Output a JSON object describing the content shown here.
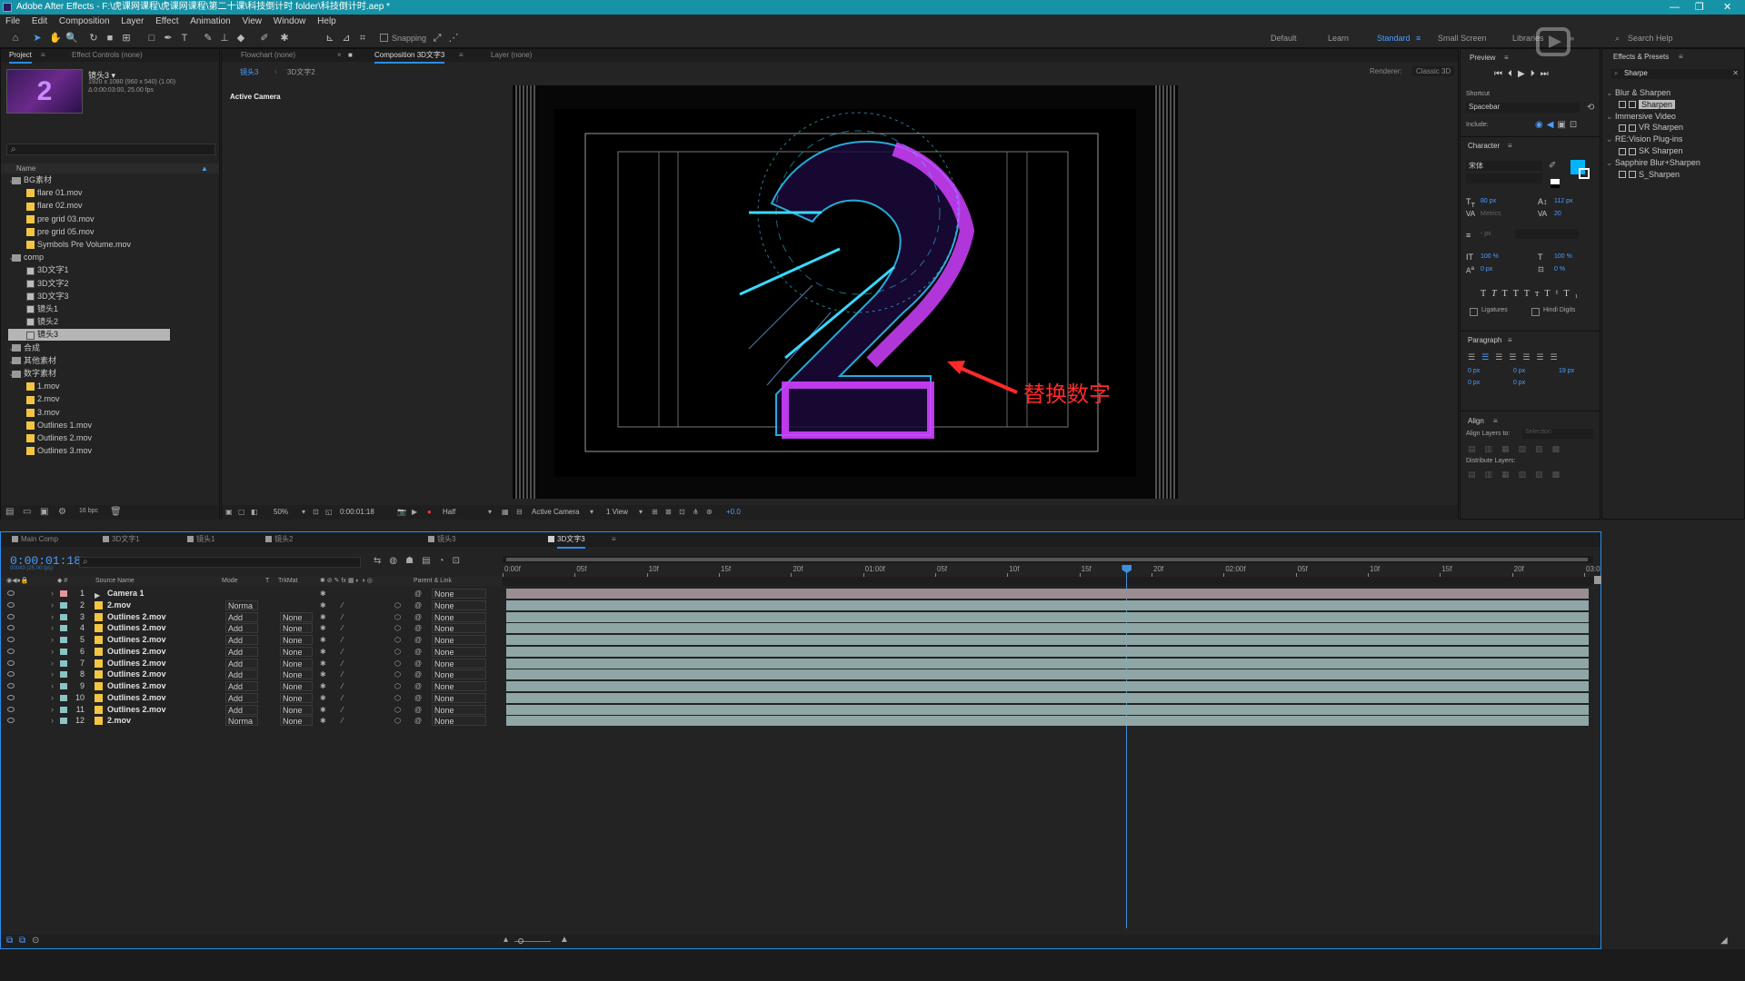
{
  "window": {
    "title": "Adobe After Effects - F:\\虎课网课程\\虎课网课程\\第二十课\\科技倒计时 folder\\科技倒计时.aep *"
  },
  "menu": [
    "File",
    "Edit",
    "Composition",
    "Layer",
    "Effect",
    "Animation",
    "View",
    "Window",
    "Help"
  ],
  "toolbar": {
    "snapping": "Snapping",
    "workspaces": [
      "Default",
      "Learn",
      "Standard",
      "Small Screen",
      "Libraries"
    ],
    "search_help": "Search Help"
  },
  "project": {
    "tab": "Project",
    "tab_effects": "Effect Controls (none)",
    "item_name": "镜头3 ▾",
    "item_info1": "1920 x 1080  (960 x 540) (1.00)",
    "item_info2": "Δ 0:00:03:00, 25.00 fps",
    "col_name": "Name",
    "rows": [
      {
        "t": "folder",
        "label": "BG素材",
        "indent": 0
      },
      {
        "t": "file",
        "label": "flare 01.mov",
        "indent": 1
      },
      {
        "t": "file",
        "label": "flare 02.mov",
        "indent": 1
      },
      {
        "t": "file",
        "label": "pre grid 03.mov",
        "indent": 1
      },
      {
        "t": "file",
        "label": "pre grid 05.mov",
        "indent": 1
      },
      {
        "t": "file",
        "label": "Symbols Pre Volume.mov",
        "indent": 1
      },
      {
        "t": "folder",
        "label": "comp",
        "indent": 0
      },
      {
        "t": "comp",
        "label": "3D文字1",
        "indent": 1
      },
      {
        "t": "comp",
        "label": "3D文字2",
        "indent": 1
      },
      {
        "t": "comp",
        "label": "3D文字3",
        "indent": 1
      },
      {
        "t": "comp",
        "label": "镜头1",
        "indent": 1
      },
      {
        "t": "comp",
        "label": "镜头2",
        "indent": 1
      },
      {
        "t": "comp",
        "label": "镜头3",
        "indent": 1,
        "sel": true
      },
      {
        "t": "folder",
        "label": "合成",
        "indent": 0
      },
      {
        "t": "folder",
        "label": "其他素材",
        "indent": 0
      },
      {
        "t": "folder",
        "label": "数字素材",
        "indent": 0
      },
      {
        "t": "file",
        "label": "1.mov",
        "indent": 1
      },
      {
        "t": "file",
        "label": "2.mov",
        "indent": 1
      },
      {
        "t": "file",
        "label": "3.mov",
        "indent": 1
      },
      {
        "t": "file",
        "label": "Outlines 1.mov",
        "indent": 1
      },
      {
        "t": "file",
        "label": "Outlines 2.mov",
        "indent": 1
      },
      {
        "t": "file",
        "label": "Outlines 3.mov",
        "indent": 1
      }
    ],
    "bpc": "16 bpc"
  },
  "viewer": {
    "tab_flowchart": "Flowchart (none)",
    "tab_comp": "Composition 3D文字3",
    "tab_layer": "Layer (none)",
    "sub_tabs": [
      "镜头3",
      "3D文字2"
    ],
    "renderer_label": "Renderer:",
    "renderer": "Classic 3D",
    "active_camera": "Active Camera",
    "annotation": "替换数字",
    "digit": "2",
    "zoom": "50%",
    "timecode": "0:00:01:18",
    "resolution": "Half",
    "view_mode": "Active Camera",
    "views": "1 View",
    "exposure": "+0.0"
  },
  "right": {
    "preview": "Preview",
    "shortcut_label": "Shortcut",
    "shortcut": "Spacebar",
    "include": "Include:",
    "character": "Character",
    "font": "宋体",
    "font_size": "80 px",
    "leading": "112 px",
    "kerning": "Metrics",
    "tracking": "20",
    "stroke_unit": "- px",
    "vscale": "100 %",
    "hscale": "100 %",
    "baseline": "0 px",
    "tsume": "0 %",
    "ligatures": "Ligatures",
    "hindi": "Hindi Digits",
    "paragraph": "Paragraph",
    "indent1": "0 px",
    "indent2": "0 px",
    "indent3": "0 px",
    "space_before": "0 px",
    "space_after": "19 px",
    "align": "Align",
    "align_to": "Align Layers to:",
    "align_sel": "Selection",
    "distribute": "Distribute Layers:"
  },
  "effects": {
    "tab": "Effects & Presets",
    "search": "Sharpe",
    "rows": [
      {
        "label": "Blur & Sharpen",
        "cat": true
      },
      {
        "label": "Sharpen",
        "cat": false,
        "hl": true
      },
      {
        "label": "Immersive Video",
        "cat": true
      },
      {
        "label": "VR Sharpen",
        "cat": false
      },
      {
        "label": "RE:Vision Plug-ins",
        "cat": true
      },
      {
        "label": "SK Sharpen",
        "cat": false
      },
      {
        "label": "Sapphire Blur+Sharpen",
        "cat": true
      },
      {
        "label": "S_Sharpen",
        "cat": false
      }
    ]
  },
  "timeline": {
    "tabs": [
      "Main Comp",
      "3D文字1",
      "镜头1",
      "镜头2",
      "镜头3",
      "3D文字3"
    ],
    "timecode": "0:00:01:18",
    "frames": "00043 (25.00 fps)",
    "col_source": "Source Name",
    "col_mode": "Mode",
    "col_t": "T",
    "col_trkmat": "TrkMat",
    "col_parent": "Parent & Link",
    "ruler": [
      "0:00f",
      "05f",
      "10f",
      "15f",
      "20f",
      "01:00f",
      "05f",
      "10f",
      "15f",
      "20f",
      "02:00f",
      "05f",
      "10f",
      "15f",
      "20f",
      "03:0"
    ],
    "layers": [
      {
        "n": "1",
        "name": "Camera 1",
        "mode": "",
        "trk": "",
        "parent": "None",
        "color": "#e39999",
        "cam": true
      },
      {
        "n": "2",
        "name": "2.mov",
        "mode": "Norma",
        "trk": "",
        "parent": "None",
        "color": "#8ac4c4"
      },
      {
        "n": "3",
        "name": "Outlines 2.mov",
        "mode": "Add",
        "trk": "None",
        "parent": "None",
        "color": "#8ac4c4"
      },
      {
        "n": "4",
        "name": "Outlines 2.mov",
        "mode": "Add",
        "trk": "None",
        "parent": "None",
        "color": "#8ac4c4"
      },
      {
        "n": "5",
        "name": "Outlines 2.mov",
        "mode": "Add",
        "trk": "None",
        "parent": "None",
        "color": "#8ac4c4"
      },
      {
        "n": "6",
        "name": "Outlines 2.mov",
        "mode": "Add",
        "trk": "None",
        "parent": "None",
        "color": "#8ac4c4"
      },
      {
        "n": "7",
        "name": "Outlines 2.mov",
        "mode": "Add",
        "trk": "None",
        "parent": "None",
        "color": "#8ac4c4"
      },
      {
        "n": "8",
        "name": "Outlines 2.mov",
        "mode": "Add",
        "trk": "None",
        "parent": "None",
        "color": "#8ac4c4"
      },
      {
        "n": "9",
        "name": "Outlines 2.mov",
        "mode": "Add",
        "trk": "None",
        "parent": "None",
        "color": "#8ac4c4"
      },
      {
        "n": "10",
        "name": "Outlines 2.mov",
        "mode": "Add",
        "trk": "None",
        "parent": "None",
        "color": "#8ac4c4"
      },
      {
        "n": "11",
        "name": "Outlines 2.mov",
        "mode": "Add",
        "trk": "None",
        "parent": "None",
        "color": "#8ac4c4"
      },
      {
        "n": "12",
        "name": "2.mov",
        "mode": "Norma",
        "trk": "None",
        "parent": "None",
        "color": "#8ac4c4"
      }
    ],
    "playhead_fraction": 0.573
  },
  "colors": {
    "accent": "#2d8ceb",
    "titlebar": "#1693a7",
    "annotation": "#ff2a2a",
    "layer_bar": "#8fa6a6",
    "camera_bar": "#9a8e92"
  }
}
